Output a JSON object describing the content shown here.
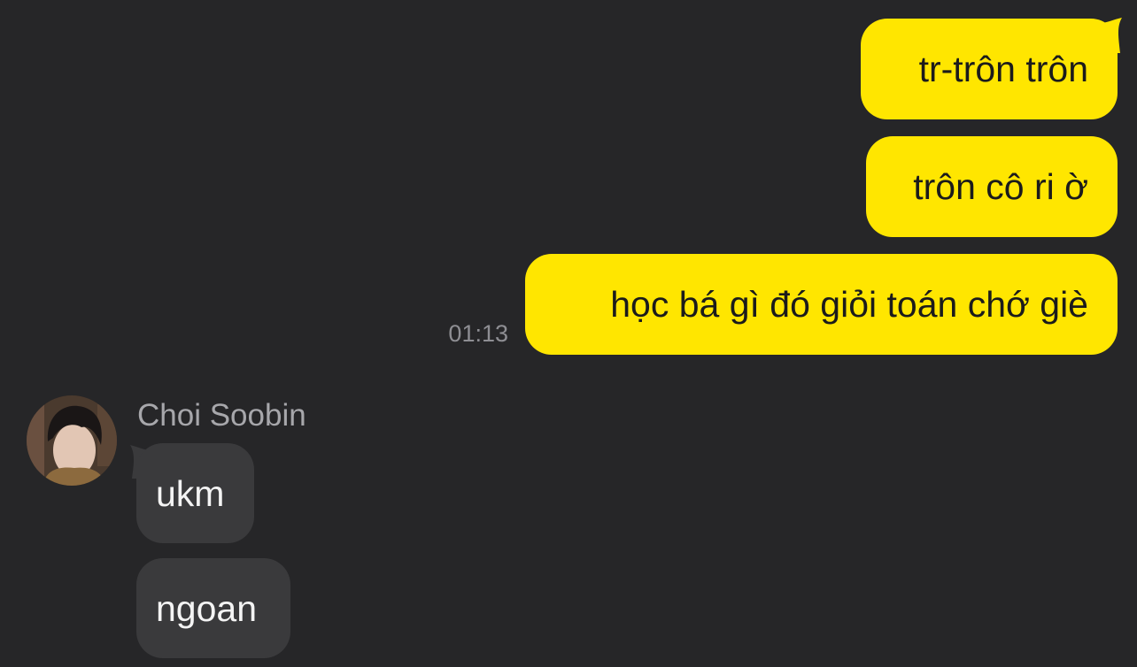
{
  "chat": {
    "outgoing": [
      {
        "text": "tr-trôn trôn"
      },
      {
        "text": "trôn cô ri ờ"
      },
      {
        "text": "học bá gì đó giỏi toán chớ giè"
      }
    ],
    "outgoing_timestamp": "01:13",
    "incoming_sender": "Choi Soobin",
    "incoming": [
      {
        "text": "ukm"
      },
      {
        "text": "ngoan"
      }
    ]
  },
  "colors": {
    "background": "#262628",
    "outgoing_bubble": "#FFE600",
    "incoming_bubble": "#3a3a3c",
    "timestamp": "#8e8e93",
    "sender_name": "#a7a7ab"
  },
  "icons": {
    "avatar": "profile-photo-icon"
  }
}
